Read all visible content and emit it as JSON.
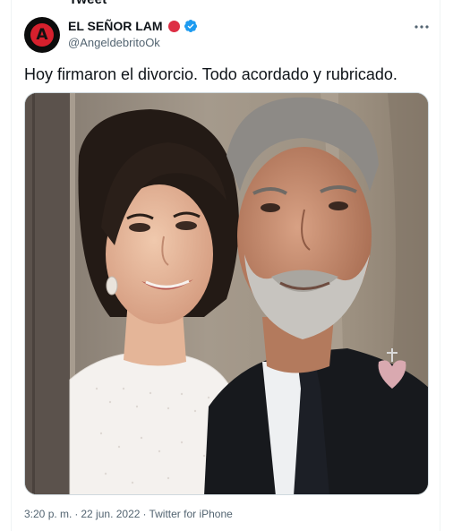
{
  "tweet": {
    "top_cut_text": "Tweet",
    "author": {
      "display_name": "EL SEÑOR LAM",
      "handle": "@AngeldebritoOk",
      "avatar_letter": "A",
      "verified": true
    },
    "text": "Hoy firmaron el divorcio. Todo acordado y rubricado.",
    "meta": {
      "time": "3:20 p. m.",
      "separator": "·",
      "date": "22 jun. 2022",
      "source": "Twitter for iPhone"
    }
  },
  "colors": {
    "text_primary": "#0f1419",
    "text_secondary": "#536471",
    "verified_blue": "#1d9bf0",
    "status_red": "#dd2e44",
    "border": "#cfd9de",
    "avatar_accent": "#d6202d"
  },
  "icons": {
    "more": "ellipsis-icon",
    "verified": "verified-badge-icon",
    "status": "red-circle-emoji-icon"
  }
}
